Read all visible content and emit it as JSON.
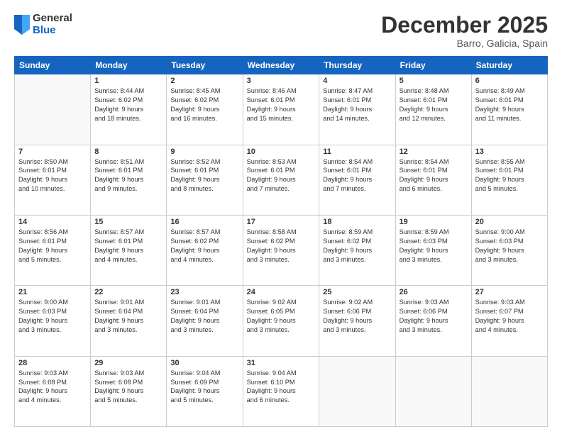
{
  "header": {
    "logo_general": "General",
    "logo_blue": "Blue",
    "month_title": "December 2025",
    "location": "Barro, Galicia, Spain"
  },
  "days_of_week": [
    "Sunday",
    "Monday",
    "Tuesday",
    "Wednesday",
    "Thursday",
    "Friday",
    "Saturday"
  ],
  "weeks": [
    [
      {
        "day": "",
        "content": ""
      },
      {
        "day": "1",
        "content": "Sunrise: 8:44 AM\nSunset: 6:02 PM\nDaylight: 9 hours\nand 18 minutes."
      },
      {
        "day": "2",
        "content": "Sunrise: 8:45 AM\nSunset: 6:02 PM\nDaylight: 9 hours\nand 16 minutes."
      },
      {
        "day": "3",
        "content": "Sunrise: 8:46 AM\nSunset: 6:01 PM\nDaylight: 9 hours\nand 15 minutes."
      },
      {
        "day": "4",
        "content": "Sunrise: 8:47 AM\nSunset: 6:01 PM\nDaylight: 9 hours\nand 14 minutes."
      },
      {
        "day": "5",
        "content": "Sunrise: 8:48 AM\nSunset: 6:01 PM\nDaylight: 9 hours\nand 12 minutes."
      },
      {
        "day": "6",
        "content": "Sunrise: 8:49 AM\nSunset: 6:01 PM\nDaylight: 9 hours\nand 11 minutes."
      }
    ],
    [
      {
        "day": "7",
        "content": "Sunrise: 8:50 AM\nSunset: 6:01 PM\nDaylight: 9 hours\nand 10 minutes."
      },
      {
        "day": "8",
        "content": "Sunrise: 8:51 AM\nSunset: 6:01 PM\nDaylight: 9 hours\nand 9 minutes."
      },
      {
        "day": "9",
        "content": "Sunrise: 8:52 AM\nSunset: 6:01 PM\nDaylight: 9 hours\nand 8 minutes."
      },
      {
        "day": "10",
        "content": "Sunrise: 8:53 AM\nSunset: 6:01 PM\nDaylight: 9 hours\nand 7 minutes."
      },
      {
        "day": "11",
        "content": "Sunrise: 8:54 AM\nSunset: 6:01 PM\nDaylight: 9 hours\nand 7 minutes."
      },
      {
        "day": "12",
        "content": "Sunrise: 8:54 AM\nSunset: 6:01 PM\nDaylight: 9 hours\nand 6 minutes."
      },
      {
        "day": "13",
        "content": "Sunrise: 8:55 AM\nSunset: 6:01 PM\nDaylight: 9 hours\nand 5 minutes."
      }
    ],
    [
      {
        "day": "14",
        "content": "Sunrise: 8:56 AM\nSunset: 6:01 PM\nDaylight: 9 hours\nand 5 minutes."
      },
      {
        "day": "15",
        "content": "Sunrise: 8:57 AM\nSunset: 6:01 PM\nDaylight: 9 hours\nand 4 minutes."
      },
      {
        "day": "16",
        "content": "Sunrise: 8:57 AM\nSunset: 6:02 PM\nDaylight: 9 hours\nand 4 minutes."
      },
      {
        "day": "17",
        "content": "Sunrise: 8:58 AM\nSunset: 6:02 PM\nDaylight: 9 hours\nand 3 minutes."
      },
      {
        "day": "18",
        "content": "Sunrise: 8:59 AM\nSunset: 6:02 PM\nDaylight: 9 hours\nand 3 minutes."
      },
      {
        "day": "19",
        "content": "Sunrise: 8:59 AM\nSunset: 6:03 PM\nDaylight: 9 hours\nand 3 minutes."
      },
      {
        "day": "20",
        "content": "Sunrise: 9:00 AM\nSunset: 6:03 PM\nDaylight: 9 hours\nand 3 minutes."
      }
    ],
    [
      {
        "day": "21",
        "content": "Sunrise: 9:00 AM\nSunset: 6:03 PM\nDaylight: 9 hours\nand 3 minutes."
      },
      {
        "day": "22",
        "content": "Sunrise: 9:01 AM\nSunset: 6:04 PM\nDaylight: 9 hours\nand 3 minutes."
      },
      {
        "day": "23",
        "content": "Sunrise: 9:01 AM\nSunset: 6:04 PM\nDaylight: 9 hours\nand 3 minutes."
      },
      {
        "day": "24",
        "content": "Sunrise: 9:02 AM\nSunset: 6:05 PM\nDaylight: 9 hours\nand 3 minutes."
      },
      {
        "day": "25",
        "content": "Sunrise: 9:02 AM\nSunset: 6:06 PM\nDaylight: 9 hours\nand 3 minutes."
      },
      {
        "day": "26",
        "content": "Sunrise: 9:03 AM\nSunset: 6:06 PM\nDaylight: 9 hours\nand 3 minutes."
      },
      {
        "day": "27",
        "content": "Sunrise: 9:03 AM\nSunset: 6:07 PM\nDaylight: 9 hours\nand 4 minutes."
      }
    ],
    [
      {
        "day": "28",
        "content": "Sunrise: 9:03 AM\nSunset: 6:08 PM\nDaylight: 9 hours\nand 4 minutes."
      },
      {
        "day": "29",
        "content": "Sunrise: 9:03 AM\nSunset: 6:08 PM\nDaylight: 9 hours\nand 5 minutes."
      },
      {
        "day": "30",
        "content": "Sunrise: 9:04 AM\nSunset: 6:09 PM\nDaylight: 9 hours\nand 5 minutes."
      },
      {
        "day": "31",
        "content": "Sunrise: 9:04 AM\nSunset: 6:10 PM\nDaylight: 9 hours\nand 6 minutes."
      },
      {
        "day": "",
        "content": ""
      },
      {
        "day": "",
        "content": ""
      },
      {
        "day": "",
        "content": ""
      }
    ]
  ]
}
